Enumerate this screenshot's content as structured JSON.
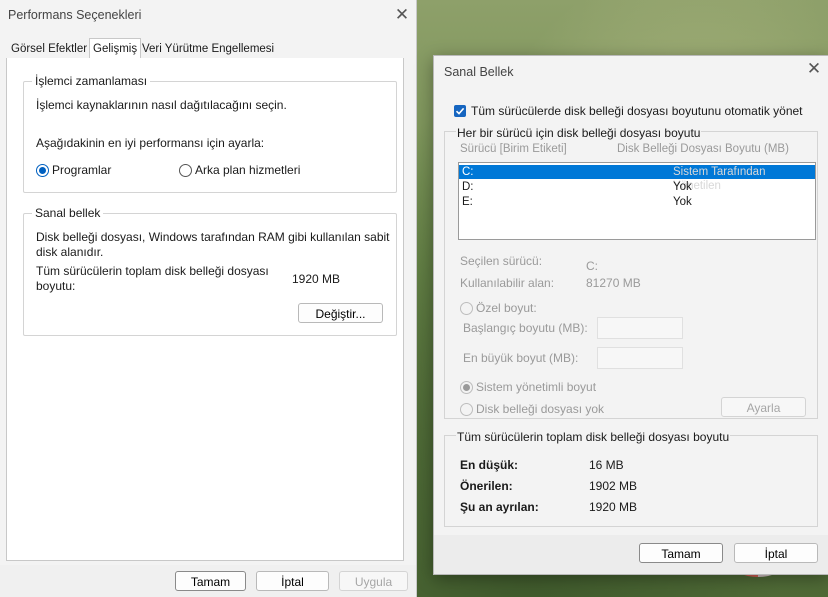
{
  "win1": {
    "title": "Performans Seçenekleri",
    "tabs": [
      "Görsel Efektler",
      "Gelişmiş",
      "Veri Yürütme Engellemesi"
    ],
    "cpu_group": {
      "title": "İşlemci zamanlaması",
      "desc": "İşlemci kaynaklarının nasıl dağıtılacağını seçin.",
      "adjust_label": "Aşağıdakinin en iyi performansı için ayarla:",
      "opt_programs": "Programlar",
      "opt_background": "Arka plan hizmetleri"
    },
    "vm_group": {
      "title": "Sanal bellek",
      "desc_line1": "Disk belleği dosyası, Windows tarafından RAM gibi kullanılan sabit",
      "desc_line2": "disk alanıdır.",
      "total_line1": "Tüm sürücülerin toplam disk belleği dosyası",
      "total_line2": "boyutu:",
      "total_value": "1920 MB",
      "change_btn": "Değiştir..."
    },
    "buttons": {
      "ok": "Tamam",
      "cancel": "İptal",
      "apply": "Uygula"
    }
  },
  "win2": {
    "title": "Sanal Bellek",
    "auto_manage": "Tüm sürücülerde disk belleği dosyası boyutunu otomatik yönet",
    "per_drive_title": "Her bir sürücü için disk belleği dosyası boyutu",
    "col_drive": "Sürücü  [Birim Etiketi]",
    "col_size": "Disk Belleği Dosyası Boyutu (MB)",
    "drives": [
      {
        "drive": "C:",
        "size": "Sistem Tarafından Yönetilen"
      },
      {
        "drive": "D:",
        "size": "Yok"
      },
      {
        "drive": "E:",
        "size": "Yok"
      }
    ],
    "selected_drive_label": "Seçilen sürücü:",
    "selected_drive_value": "C:",
    "available_label": "Kullanılabilir alan:",
    "available_value": "81270 MB",
    "custom_size": "Özel boyut:",
    "initial_size": "Başlangıç boyutu (MB):",
    "max_size": "En büyük boyut (MB):",
    "system_managed": "Sistem yönetimli boyut",
    "no_paging": "Disk belleği dosyası yok",
    "set_btn": "Ayarla",
    "totals_title": "Tüm sürücülerin toplam disk belleği dosyası boyutu",
    "min_label": "En düşük:",
    "min_value": "16 MB",
    "recommended_label": "Önerilen:",
    "recommended_value": "1902 MB",
    "current_label": "Şu an ayrılan:",
    "current_value": "1920 MB",
    "buttons": {
      "ok": "Tamam",
      "cancel": "İptal"
    }
  },
  "colors": {
    "accent": "#0060c0",
    "selection": "#0078d7",
    "disabled_text": "#9a9a9a"
  }
}
